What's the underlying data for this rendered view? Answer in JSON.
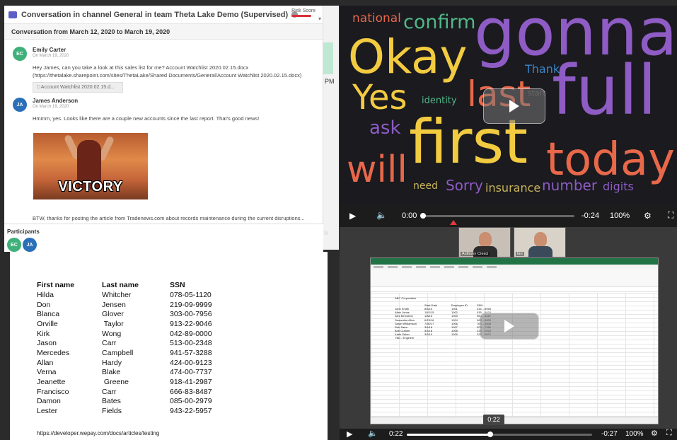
{
  "chat": {
    "title": "Conversation in channel General in team Theta Lake Demo (Supervised)",
    "risk_label": "Risk Score",
    "range": "Conversation from March 12, 2020 to March 19, 2020",
    "messages": [
      {
        "initials": "EC",
        "name": "Emily Carter",
        "date": "On March 19, 2020",
        "line1": "Hey James, can you take a look at this sales list for me? Account Watchlist 2020.02.15.docx",
        "line2": "(https://thetalake.sharepoint.com/sites/ThetaLake/Shared Documents/General/Account Watchlist 2020.02.15.docx)",
        "attachment": "Account Watchlist 2020.02.15.d..."
      },
      {
        "initials": "JA",
        "name": "James Anderson",
        "date": "On March 19, 2020",
        "line1": "Hmmm, yes.  Looks like there are a couple new accounts since the last report.  That's good news!",
        "gif_caption": "VICTORY"
      }
    ],
    "btw": "BTW, thanks for posting the article from Tradenews.com about records maintenance during the current disruptions...",
    "participants_label": "Participants",
    "participants": [
      "EC",
      "JA"
    ],
    "side_text": "PM"
  },
  "doc": {
    "headers": [
      "First name",
      "Last name",
      "SSN"
    ],
    "rows": [
      [
        "Hilda",
        "Whitcher",
        "078-05-1120"
      ],
      [
        "Don",
        "Jensen",
        "219-09-9999"
      ],
      [
        "Blanca",
        "Glover",
        "303-00-7956"
      ],
      [
        "Orville",
        " Taylor",
        "913-22-9046"
      ],
      [
        "Kirk",
        "Wong",
        "042-89-0000"
      ],
      [
        "Jason",
        "Carr",
        "513-00-2348"
      ],
      [
        "Mercedes",
        "Campbell",
        "941-57-3288"
      ],
      [
        "Allan",
        "Hardy",
        "424-00-9123"
      ],
      [
        "Verna",
        "Blake",
        "474-00-7737"
      ],
      [
        "Jeanette",
        " Greene",
        "918-41-2987"
      ],
      [
        "Francisco",
        "Carr",
        "666-83-8487"
      ],
      [
        "Damon",
        "Bates",
        "085-00-2979"
      ],
      [
        "Lester",
        "Fields",
        "943-22-5957"
      ]
    ],
    "link": "https://developer.wepay.com/docs/articles/testing"
  },
  "wordcloud": {
    "words": [
      {
        "text": "national",
        "color": "#e8684a"
      },
      {
        "text": "confirm",
        "color": "#52b788"
      },
      {
        "text": "gonna",
        "color": "#8e5cc4"
      },
      {
        "text": "Okay",
        "color": "#f2cb41"
      },
      {
        "text": "Thank",
        "color": "#3a86c8"
      },
      {
        "text": "Yes",
        "color": "#f2cb41"
      },
      {
        "text": "last",
        "color": "#e8684a"
      },
      {
        "text": "identity",
        "color": "#52b788"
      },
      {
        "text": "start",
        "color": "#555555"
      },
      {
        "text": "full",
        "color": "#8e5cc4"
      },
      {
        "text": "ask",
        "color": "#8e5cc4"
      },
      {
        "text": "first",
        "color": "#f2cb41"
      },
      {
        "text": "today",
        "color": "#e8684a"
      },
      {
        "text": "will",
        "color": "#e8684a"
      },
      {
        "text": "need",
        "color": "#c9b458"
      },
      {
        "text": "Sorry",
        "color": "#8e5cc4"
      },
      {
        "text": "insurance",
        "color": "#c9b458"
      },
      {
        "text": "number",
        "color": "#8e5cc4"
      },
      {
        "text": "digits",
        "color": "#8e5cc4"
      }
    ]
  },
  "player1": {
    "current": "0:00",
    "remaining": "-0:24",
    "zoom": "100%",
    "progress": 0.0
  },
  "meeting": {
    "cams": [
      {
        "label": "Anthony Cresci"
      },
      {
        "label": "Ian"
      }
    ],
    "excel_company": "ABC Corporation",
    "excel_headers": [
      "",
      "Start Date",
      "Employee ID",
      "SSN"
    ],
    "excel_rows": [
      [
        "John Smith",
        "8/5/15",
        "1001",
        "234 ...8954"
      ],
      [
        "Allen Jones",
        "10/2/15",
        "1002",
        "435 ...5474"
      ],
      [
        "Alex Bernstein",
        "1/8/16",
        "1003",
        "984 ...3467"
      ],
      [
        "Samantha Allen",
        "6/23/16",
        "1004",
        "983 ...4509"
      ],
      [
        "Sarah Williamson",
        "7/30/17",
        "1006",
        "763 ...4808"
      ],
      [
        "Rob Sator",
        "3/4/18",
        "1007",
        "209 ...7382"
      ],
      [
        "Bob Cramer",
        "5/4/18",
        "1008",
        "238 ...0928"
      ],
      [
        "Katie Saher",
        "3/5/19",
        "1009",
        "220 ...9872"
      ],
      [
        "TBD - Engineer",
        "",
        "",
        ""
      ]
    ],
    "time_tip": "0:22"
  },
  "player2": {
    "current": "0:22",
    "remaining": "-0:27",
    "zoom": "100%",
    "progress": 0.45
  }
}
